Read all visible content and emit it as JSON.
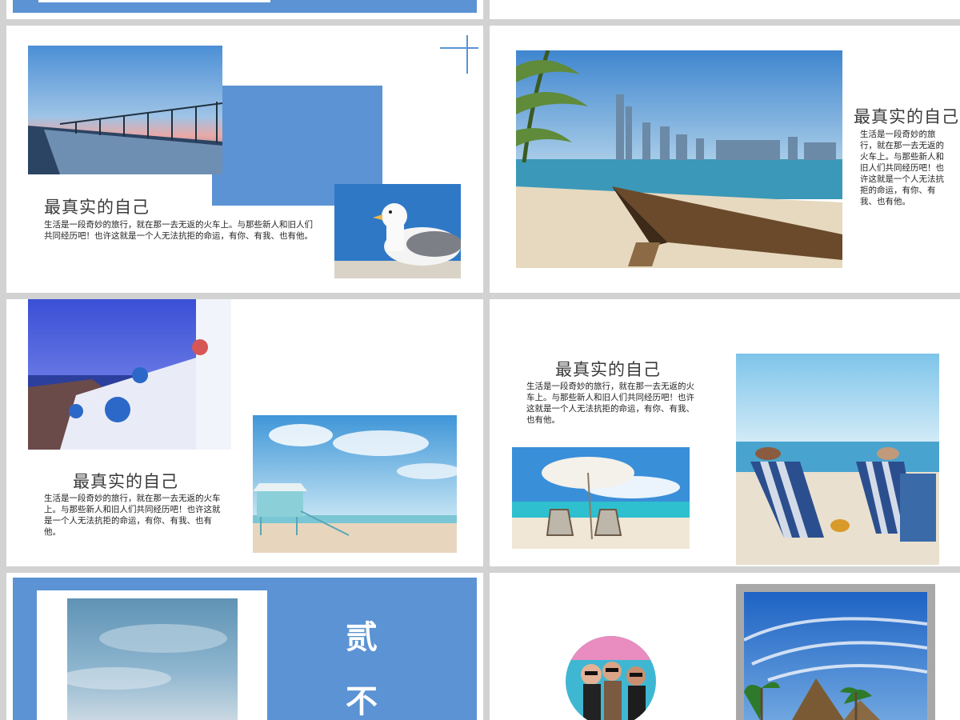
{
  "slides": {
    "s2": {
      "title": "最真实的自己",
      "body": "生活是一段奇妙的旅行，就在那一去无返的火车上。与那些新人和旧人们共同经历吧！也许这就是一个人无法抗拒的命运，有你、有我、也有他。"
    },
    "s3": {
      "title": "最真实的自己",
      "body": "生活是一段奇妙的旅行，就在那一去无返的火车上。与那些新人和旧人们共同经历吧！也许这就是一个人无法抗拒的命运，有你、有我、也有他。"
    },
    "s4": {
      "title": "最真实的自己",
      "body": "生活是一段奇妙的旅行，就在那一去无返的火车上。与那些新人和旧人们共同经历吧！也许这就是一个人无法抗拒的命运，有你、有我、也有他。"
    },
    "s5": {
      "title": "最真实的自己",
      "body": "生活是一段奇妙的旅行，就在那一去无返的火车上。与那些新人和旧人们共同经历吧！也许这就是一个人无法抗拒的命运，有你、有我、也有他。"
    },
    "s6": {
      "char1": "贰",
      "char2": "不"
    }
  },
  "colors": {
    "accent": "#5b93d4",
    "background": "#d2d2d2",
    "slide": "#ffffff"
  }
}
